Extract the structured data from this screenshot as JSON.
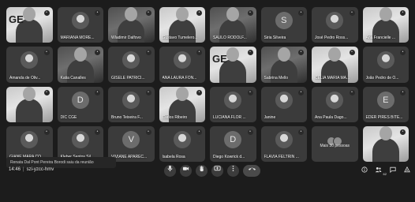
{
  "participants": [
    {
      "name": "",
      "kind": "video",
      "tone": "light",
      "logo": "GE"
    },
    {
      "name": "MARIANA MORE...",
      "kind": "photo"
    },
    {
      "name": "Wladimir Dalfovo",
      "kind": "video",
      "tone": "dark"
    },
    {
      "name": "Gustavo Tumelero...",
      "kind": "video",
      "tone": "light"
    },
    {
      "name": "SAULO RODOLF...",
      "kind": "video",
      "tone": "dark"
    },
    {
      "name": "Siria Silveira",
      "kind": "letter",
      "letter": "S"
    },
    {
      "name": "José Pedro Ross...",
      "kind": "photo"
    },
    {
      "name": "Ana Francielle ...",
      "kind": "video",
      "tone": "light"
    },
    {
      "name": "Amanda de Oliv...",
      "kind": "photo"
    },
    {
      "name": "Katia Canalles",
      "kind": "video",
      "tone": "dark"
    },
    {
      "name": "GISELE PATRICI...",
      "kind": "photo"
    },
    {
      "name": "ANA LAURA FON...",
      "kind": "photo"
    },
    {
      "name": "",
      "kind": "video",
      "tone": "light",
      "logo": "GE"
    },
    {
      "name": "Sabrina Mello",
      "kind": "video",
      "tone": "dark"
    },
    {
      "name": "CELIA MARIA MA...",
      "kind": "video",
      "tone": "light"
    },
    {
      "name": "João Pedro de O...",
      "kind": "photo"
    },
    {
      "name": "",
      "kind": "video",
      "tone": "light"
    },
    {
      "name": "DIC CGE",
      "kind": "letter",
      "letter": "D"
    },
    {
      "name": "Bruno Teixeira F...",
      "kind": "photo"
    },
    {
      "name": "Carlos Ribeiro",
      "kind": "video",
      "tone": "light"
    },
    {
      "name": "LUCIANA FLOR ...",
      "kind": "photo"
    },
    {
      "name": "Janine",
      "kind": "photo"
    },
    {
      "name": "Ana Paula Dago...",
      "kind": "photo"
    },
    {
      "name": "EDER PIRES BITE...",
      "kind": "letter",
      "letter": "E"
    },
    {
      "name": "GIANE MARA CO...",
      "kind": "photo"
    },
    {
      "name": "Kleber Santos Sil...",
      "kind": "photo"
    },
    {
      "name": "VIVIANE APAREC...",
      "kind": "letter",
      "letter": "V"
    },
    {
      "name": "Isabela Rosa",
      "kind": "photo"
    },
    {
      "name": "Diego Kowrick d...",
      "kind": "letter",
      "letter": "D"
    },
    {
      "name": "FLÁVIA FELTRIN ...",
      "kind": "photo"
    },
    {
      "name": "",
      "kind": "more",
      "more_label": "Mais 30 pessoas"
    },
    {
      "name": "",
      "kind": "video",
      "tone": "light"
    }
  ],
  "toast": "Renata Dal Pont Pereira Borodi saiu da reunião",
  "meeting": {
    "time": "14:46",
    "separator": "|",
    "code": "szi-yzcc-hmv"
  },
  "icons": {
    "mic": "microphone-icon",
    "camera": "camera-icon",
    "hand": "raise-hand-icon",
    "present": "present-screen-icon",
    "more": "more-options-icon",
    "leave": "leave-call-icon",
    "info": "info-icon",
    "people": "people-icon",
    "people_count": "62",
    "chat": "chat-icon",
    "activities": "activities-icon"
  }
}
